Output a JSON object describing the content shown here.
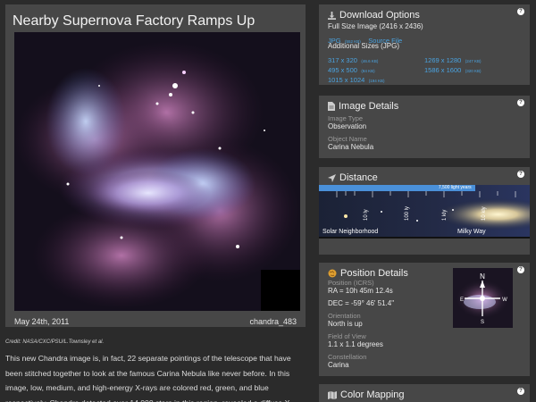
{
  "article": {
    "title": "Nearby Supernova Factory Ramps Up",
    "date": "May 24th, 2011",
    "id": "chandra_483",
    "credit": "Credit: NASA/CXC/PSU/L.Townsley et al.",
    "description": "This new Chandra image is, in fact, 22 separate pointings of the telescope that have been stitched together to look at the famous Carina Nebula like never before. In this image, low, medium, and high-energy X-rays are colored red, green, and blue respectively. Chandra detected over 14,000 stars in this region, revealed a diffuse X-"
  },
  "download": {
    "heading": "Download Options",
    "full_size": "Full Size Image (2416 x 2436)",
    "jpg_label": "JPG",
    "jpg_size": "(552 KB)",
    "source_label": "Source File",
    "additional_heading": "Additional Sizes (JPG)",
    "sizes": [
      {
        "label": "317 x 320",
        "size": "(46.6 KB)"
      },
      {
        "label": "1269 x 1280",
        "size": "(247 KB)"
      },
      {
        "label": "495 x 500",
        "size": "(84 KB)"
      },
      {
        "label": "1586 x 1600",
        "size": "(320 KB)"
      },
      {
        "label": "1015 x 1024",
        "size": "(194 KB)"
      }
    ]
  },
  "image_details": {
    "heading": "Image Details",
    "type_label": "Image Type",
    "type_value": "Observation",
    "name_label": "Object Name",
    "name_value": "Carina Nebula"
  },
  "distance": {
    "heading": "Distance",
    "bar_label": "7,500 light years",
    "bar_fraction": 0.74,
    "ticks": [
      "10 ly",
      "100 ly",
      "1 kly",
      "10 kly"
    ],
    "left_label": "Solar Neighborhood",
    "right_label": "Milky Way"
  },
  "position": {
    "heading": "Position Details",
    "pos_label": "Position (ICRS)",
    "ra": "RA = 10h 45m 12.4s",
    "dec": "DEC = -59° 46' 51.4\"",
    "orient_label": "Orientation",
    "orient_value": "North is up",
    "fov_label": "Field of View",
    "fov_value": "1.1 x 1.1 degrees",
    "const_label": "Constellation",
    "const_value": "Carina",
    "compass": {
      "n": "N",
      "e": "E",
      "s": "S",
      "w": "W"
    }
  },
  "color_mapping": {
    "heading": "Color Mapping"
  },
  "help_glyph": "?"
}
